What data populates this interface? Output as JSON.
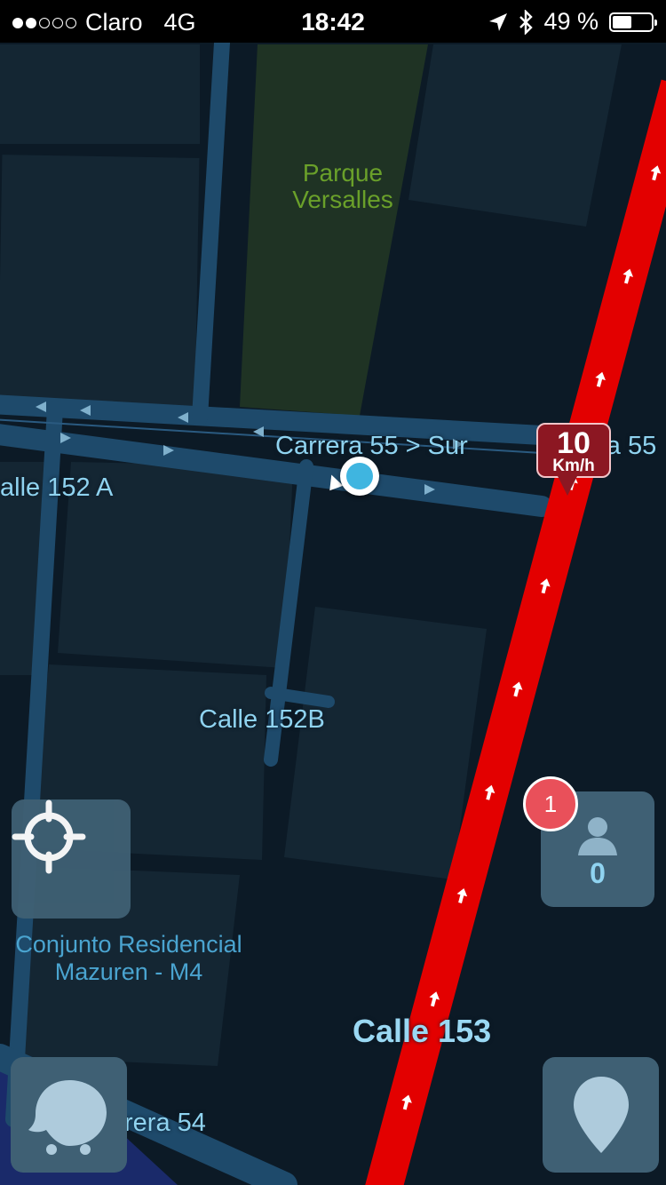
{
  "status_bar": {
    "carrier": "Claro",
    "network": "4G",
    "time": "18:42",
    "battery_text": "49 %",
    "battery_level": 0.49,
    "signal_bars_filled": 2,
    "signal_bars_total": 5,
    "icons": [
      "location-arrow-icon",
      "bluetooth-icon",
      "battery-icon"
    ]
  },
  "map": {
    "park_name_line1": "Parque",
    "park_name_line2": "Versalles",
    "streets": {
      "carrera_55_sur": "Carrera 55 > Sur",
      "carrera_55_partial": "era 55",
      "calle_152a": "alle 152 A",
      "calle_152b": "Calle 152B",
      "calle_153": "Calle 153",
      "carrera_54": "rera 54"
    },
    "poi_line1": "Conjunto Residencial",
    "poi_line2": "Mazuren - M4",
    "colors": {
      "background": "#0c1a26",
      "road": "#1e4a6b",
      "park": "#1f3324",
      "traffic_jam": "#e30000"
    }
  },
  "speed_limit": {
    "value": "10",
    "unit": "Km/h"
  },
  "controls": {
    "recenter_icon": "crosshair-icon",
    "people_icon": "person-icon",
    "people_count": "0",
    "notification_badge": "1",
    "report_icon": "waze-report-icon",
    "pin_icon": "map-pin-icon"
  }
}
